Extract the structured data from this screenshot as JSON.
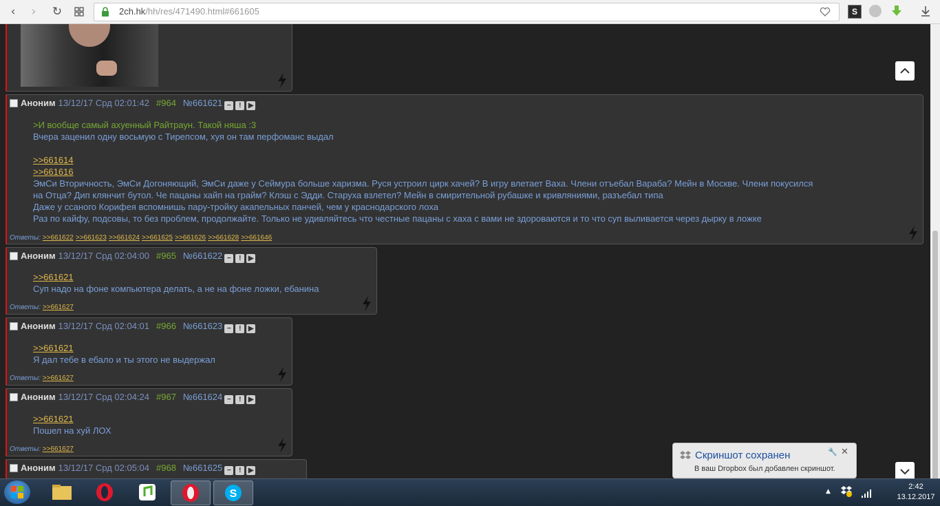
{
  "browser": {
    "url_host": "2ch.hk",
    "url_path": "/hh/res/471490.html#661605"
  },
  "posts": [
    {
      "name": "Аноним",
      "date": "13/12/17 Срд 02:01:42",
      "num": "#964",
      "id": "№661621",
      "lines": [
        {
          "text": ">И вообще самый ахуенный Райтраун. Такой няша :3",
          "kind": "green"
        },
        {
          "text": "Вчера заценил одну восьмую с Тирепсом, хуя он там перфоманс выдал",
          "kind": "plain"
        },
        {
          "text": "",
          "kind": "blank"
        },
        {
          "text": ">>661614",
          "kind": "ref"
        },
        {
          "text": ">>661616",
          "kind": "ref"
        },
        {
          "text": "ЭмСи Вторичность, ЭмСи Догоняющий, ЭмСи даже у Сеймура больше харизма. Руся устроил цирк хачей? В игру влетает Ваха. Члени отъебал Вараба? Мейн в Москве. Члени покусился",
          "kind": "plain"
        },
        {
          "text": "на Отца? Дип клянчит бутол. Че пацаны хайп на грайм? Клэш с Эдди. Старуха взлетел? Мейн в смирительной рубашке и кривляниями, разъебал типа",
          "kind": "plain"
        },
        {
          "text": "Даже у ссаного Корифея вспомнишь пару-тройку акапельных панчей, чем у краснодарского лоха",
          "kind": "plain"
        },
        {
          "text": "Раз по кайфу, подсовы, то без проблем, продолжайте. Только не удивляйтесь что честные пацаны с хаха с вами не здороваются и то что суп выливается через дырку в ложке",
          "kind": "plain"
        }
      ],
      "replies_label": "Ответы:",
      "replies": [
        ">>661622",
        ">>661623",
        ">>661624",
        ">>661625",
        ">>661626",
        ">>661628",
        ">>661646"
      ]
    },
    {
      "name": "Аноним",
      "date": "13/12/17 Срд 02:04:00",
      "num": "#965",
      "id": "№661622",
      "lines": [
        {
          "text": ">>661621",
          "kind": "ref"
        },
        {
          "text": "Суп надо на фоне компьютера делать, а не на фоне ложки, ебанина",
          "kind": "plain"
        }
      ],
      "replies_label": "Ответы:",
      "replies": [
        ">>661627"
      ]
    },
    {
      "name": "Аноним",
      "date": "13/12/17 Срд 02:04:01",
      "num": "#966",
      "id": "№661623",
      "lines": [
        {
          "text": ">>661621",
          "kind": "ref"
        },
        {
          "text": "Я дал тебе в ебало и ты этого не выдержал",
          "kind": "plain"
        }
      ],
      "replies_label": "Ответы:",
      "replies": [
        ">>661627"
      ]
    },
    {
      "name": "Аноним",
      "date": "13/12/17 Срд 02:04:24",
      "num": "#967",
      "id": "№661624",
      "lines": [
        {
          "text": ">>661621",
          "kind": "ref"
        },
        {
          "text": "Пошел на хуй ЛОХ",
          "kind": "plain"
        }
      ],
      "replies_label": "Ответы:",
      "replies": [
        ">>661627"
      ]
    },
    {
      "name": "Аноним",
      "date": "13/12/17 Срд 02:05:04",
      "num": "#968",
      "id": "№661625",
      "lines": [],
      "replies_label": "",
      "replies": []
    }
  ],
  "post_buttons": [
    "−",
    "!",
    "▶"
  ],
  "notification": {
    "title": "Скриншот сохранен",
    "text": "В ваш Dropbox был добавлен скриншот."
  },
  "clock": {
    "time": "2:42",
    "date": "13.12.2017"
  },
  "icons": {
    "back": "back-arrow-icon",
    "forward": "forward-arrow-icon",
    "reload": "reload-icon",
    "apps": "apps-grid-icon",
    "secure": "lock-icon",
    "bookmark": "heart-icon",
    "download": "download-icon"
  },
  "colors": {
    "post_bg": "#333333",
    "post_border_accent": "#e41010",
    "greentext": "#78a832",
    "text_blue": "#7a9fd8",
    "reflink": "#e0b84a",
    "taskbar": "#1b2a3b"
  }
}
